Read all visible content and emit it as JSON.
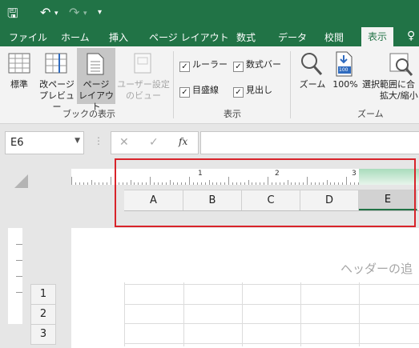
{
  "quick_access": {
    "save_icon": "save-icon",
    "undo_icon": "undo-icon",
    "redo_icon": "redo-icon",
    "customize_icon": "customize-qat-icon"
  },
  "tabs": [
    "ファイル",
    "ホーム",
    "挿入",
    "ページ レイアウト",
    "数式",
    "データ",
    "校閲",
    "表示"
  ],
  "active_tab": "表示",
  "ribbon": {
    "workbook_views": {
      "normal": "標準",
      "page_break_preview_1": "改ページ",
      "page_break_preview_2": "プレビュー",
      "page_layout_1": "ページ",
      "page_layout_2": "レイアウト",
      "custom_views_1": "ユーザー設定",
      "custom_views_2": "のビュー",
      "group_label": "ブックの表示"
    },
    "show": {
      "ruler": "ルーラー",
      "formula_bar": "数式バー",
      "gridlines": "目盛線",
      "headings": "見出し",
      "group_label": "表示"
    },
    "zoom": {
      "zoom": "ズーム",
      "zoom_100": "100%",
      "zoom_selection_1": "選択範囲に合",
      "zoom_selection_2": "拡大/縮小",
      "group_label": "ズーム",
      "zoom_100_badge": "100"
    }
  },
  "formula_bar": {
    "name_box": "E6",
    "cancel": "✕",
    "enter": "✓",
    "fx": "fx",
    "value": ""
  },
  "ruler": {
    "marks": [
      "1",
      "2",
      "3"
    ]
  },
  "columns": [
    "A",
    "B",
    "C",
    "D",
    "E"
  ],
  "selected_column": "E",
  "rows": [
    "1",
    "2",
    "3"
  ],
  "page_header_placeholder": "ヘッダーの追",
  "colors": {
    "excel_green": "#217346",
    "highlight_red": "#d8232a"
  }
}
